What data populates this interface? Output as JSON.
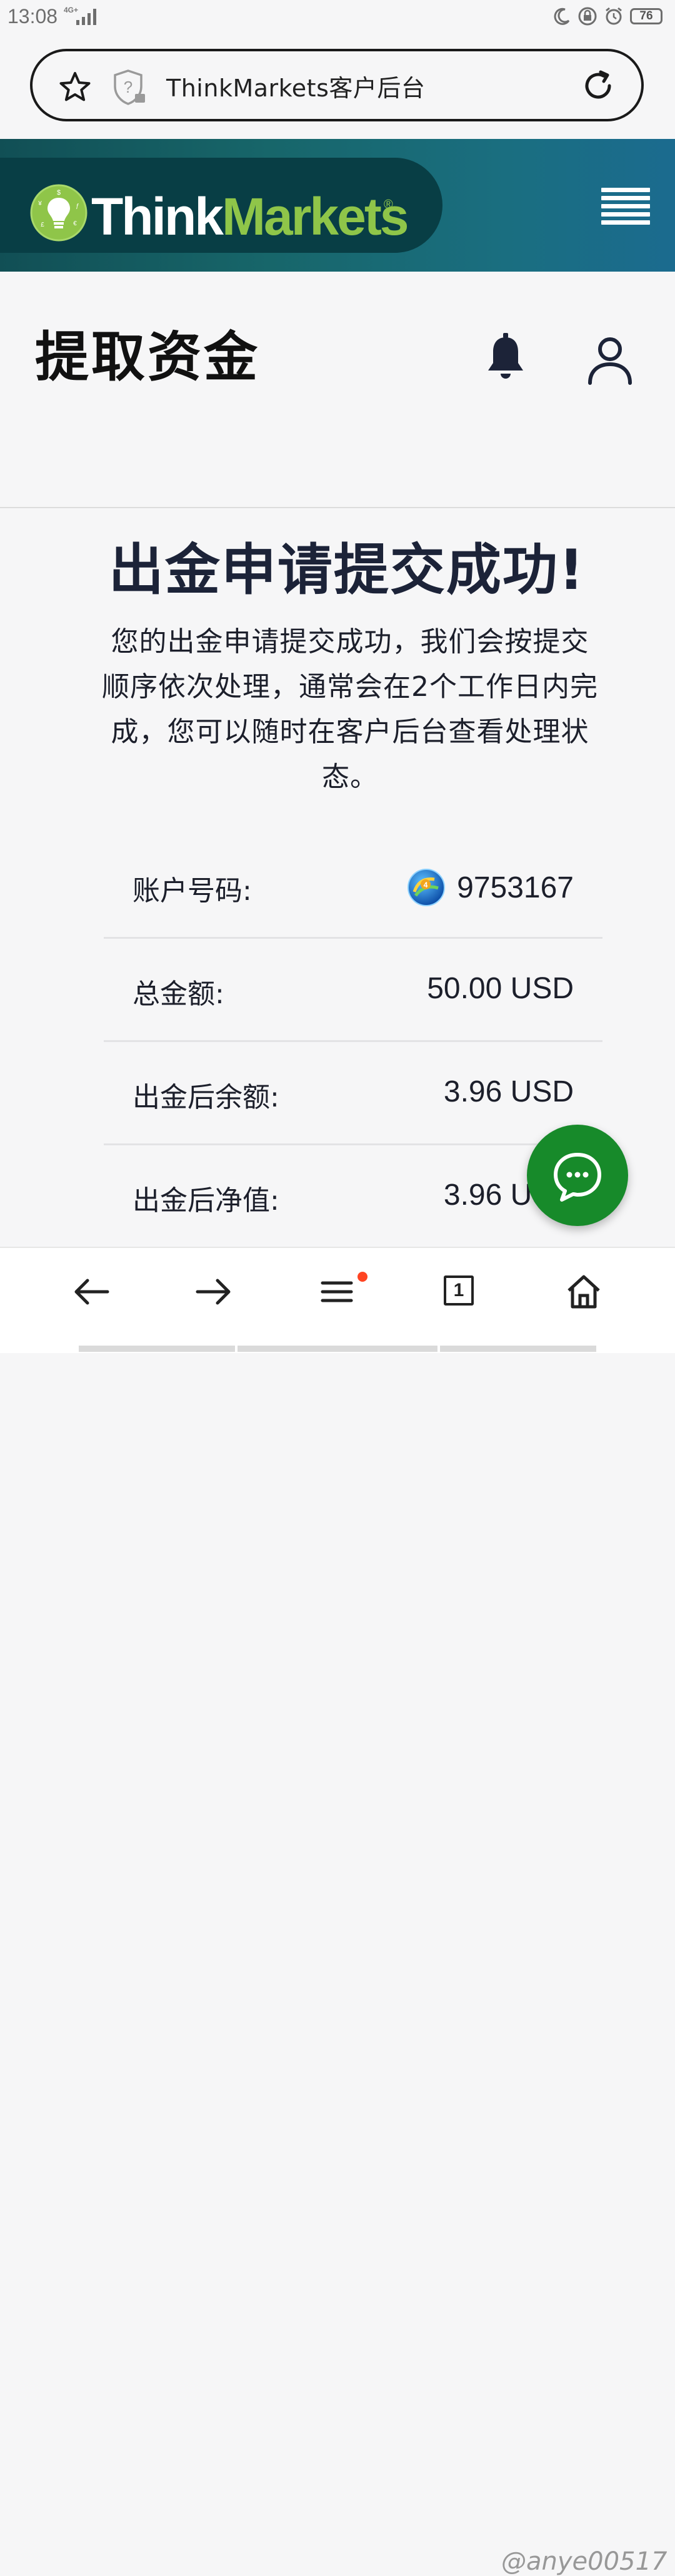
{
  "status_bar": {
    "time": "13:08",
    "network": "4G+",
    "battery": "76"
  },
  "browser": {
    "address_title": "ThinkMarkets客户后台",
    "tab_count": "1"
  },
  "header": {
    "logo_think": "Think",
    "logo_markets": "Markets",
    "logo_registered": "®"
  },
  "page": {
    "title": "提取资金"
  },
  "success": {
    "title": "出金申请提交成功!",
    "description": "您的出金申请提交成功，我们会按提交顺序依次处理，通常会在2个工作日内完成，您可以随时在客户后台查看处理状态。"
  },
  "details": [
    {
      "label": "账户号码:",
      "value": "9753167"
    },
    {
      "label": "总金额:",
      "value": "50.00 USD"
    },
    {
      "label": "出金后余额:",
      "value": "3.96 USD"
    },
    {
      "label": "出金后净值:",
      "value": "3.96 USD"
    }
  ],
  "watermark": "@anye00517",
  "colors": {
    "brand_green": "#8fc549",
    "header_dark": "#083e45",
    "chat_green": "#178a2a",
    "notification_red": "#ff4422"
  },
  "icons": {
    "address_bar": [
      "star-icon",
      "shield-question-icon",
      "reload-icon"
    ],
    "header": [
      "lightbulb-logo-icon",
      "hamburger-menu-icon"
    ],
    "page": [
      "bell-icon",
      "user-icon"
    ],
    "bottom_nav": [
      "back-arrow-icon",
      "forward-arrow-icon",
      "menu-icon",
      "tabs-icon",
      "home-icon"
    ]
  }
}
